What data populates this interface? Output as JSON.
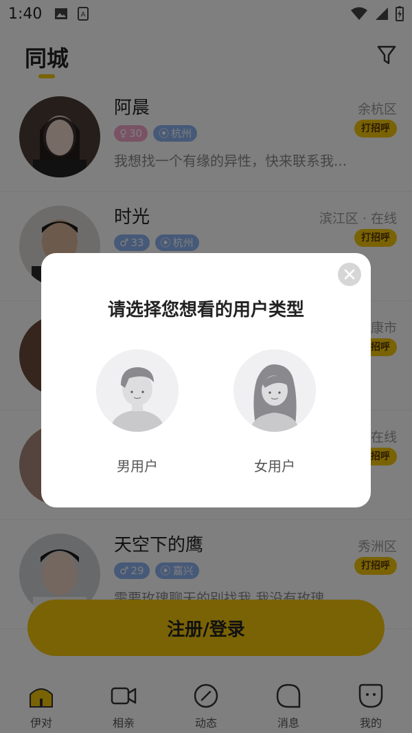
{
  "status_bar": {
    "time": "1:40"
  },
  "header": {
    "title": "同城"
  },
  "users": [
    {
      "name": "阿晨",
      "location": "余杭区",
      "gender": "female",
      "age": "30",
      "city": "杭州",
      "bio": "我想找一个有缘的异性，快来联系我...",
      "greet": "打招呼"
    },
    {
      "name": "时光",
      "location": "滨江区 · 在线",
      "gender": "male",
      "age": "33",
      "city": "杭州",
      "bio": "",
      "greet": "打招呼"
    },
    {
      "name": "",
      "location": "康市",
      "gender": "",
      "age": "",
      "city": "",
      "bio": "",
      "greet": "招呼"
    },
    {
      "name": "",
      "location": "在线",
      "gender": "",
      "age": "",
      "city": "",
      "bio": "",
      "greet": "招呼"
    },
    {
      "name": "天空下的鹰",
      "location": "秀洲区",
      "gender": "male",
      "age": "29",
      "city": "嘉兴",
      "bio": "需要玫瑰聊天的别找我 我没有玫瑰",
      "greet": "打招呼"
    }
  ],
  "register_button": "注册/登录",
  "tabbar": [
    {
      "label": "伊对",
      "icon": "home-icon"
    },
    {
      "label": "相亲",
      "icon": "video-icon"
    },
    {
      "label": "动态",
      "icon": "compass-icon"
    },
    {
      "label": "消息",
      "icon": "message-icon"
    },
    {
      "label": "我的",
      "icon": "profile-icon"
    }
  ],
  "modal": {
    "title": "请选择您想看的用户类型",
    "options": [
      {
        "label": "男用户"
      },
      {
        "label": "女用户"
      }
    ]
  },
  "colors": {
    "accent": "#F5C60A",
    "female_tag": "#F2A4C8",
    "male_tag": "#8DB3F0"
  }
}
